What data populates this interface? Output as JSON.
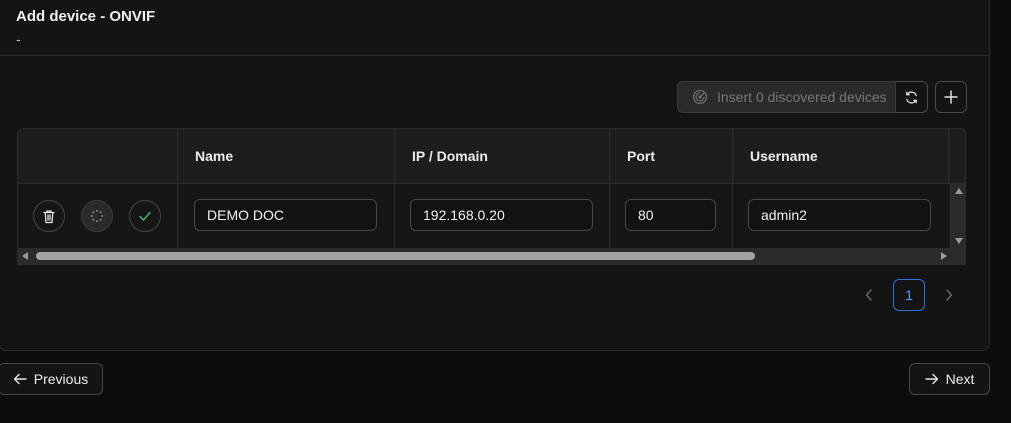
{
  "header": {
    "title": "Add device - ONVIF",
    "subtitle": "-"
  },
  "toolbar": {
    "insert_label": "Insert 0 discovered devices",
    "icons": [
      "radar-icon",
      "refresh-icon",
      "plus-icon"
    ]
  },
  "table": {
    "columns": [
      "",
      "Name",
      "IP / Domain",
      "Port",
      "Username"
    ],
    "rows": [
      {
        "actions": [
          "trash-icon",
          "spinner-icon",
          "check-icon"
        ],
        "name": "DEMO DOC",
        "ip": "192.168.0.20",
        "port": "80",
        "username": "admin2"
      }
    ]
  },
  "pagination": {
    "current_page": "1",
    "icons": [
      "chevron-left-icon",
      "chevron-right-icon"
    ]
  },
  "footer": {
    "previous_label": "Previous",
    "next_label": "Next"
  },
  "colors": {
    "background": "#0d0d0d",
    "panel": "#141414",
    "accent_blue": "#2f6fd6",
    "success_green": "#3fb870"
  }
}
